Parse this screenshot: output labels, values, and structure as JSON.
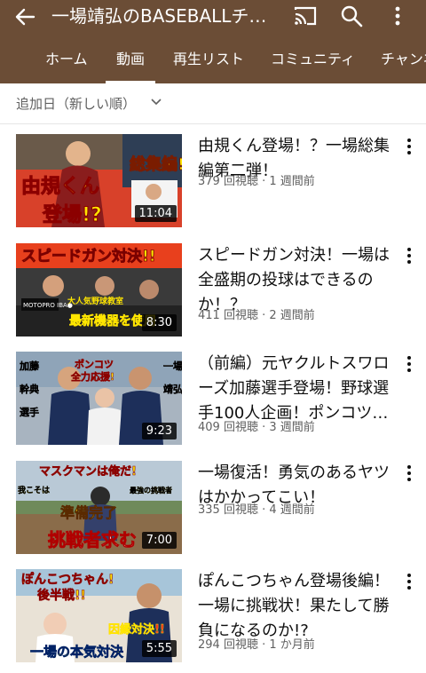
{
  "channel": {
    "title": "一場靖弘のBASEBALLチ…"
  },
  "tabs": [
    {
      "label": "ホーム"
    },
    {
      "label": "動画"
    },
    {
      "label": "再生リスト"
    },
    {
      "label": "コミュニティ"
    },
    {
      "label": "チャンネル"
    }
  ],
  "active_tab": "動画",
  "sort": {
    "label": "追加日（新しい順）"
  },
  "videos": [
    {
      "title": "由規くん登場！？一場総集編第二弾！",
      "views": "379 回視聴",
      "age": "1 週間前",
      "duration": "11:04",
      "thumb_text": [
        "総集編!",
        "由規くん",
        "登場!?"
      ]
    },
    {
      "title": "スピードガン対決！一場は全盛期の投球はできるのか！？",
      "views": "411 回視聴",
      "age": "2 週間前",
      "duration": "8:30",
      "thumb_text": [
        "スピードガン対決!!",
        "大人気野球教室",
        "最新機器を使用",
        "MOTOPRO IBA●"
      ]
    },
    {
      "title": "（前編）元ヤクルトスワローズ加藤選手登場！野球選手100人企画！ポンコツ…",
      "views": "409 回視聴",
      "age": "3 週間前",
      "duration": "9:23",
      "thumb_text": [
        "ポンコツ",
        "全力応援!",
        "加藤",
        "幹典",
        "選手",
        "一場",
        "靖弘"
      ]
    },
    {
      "title": "一場復活！勇気のあるヤツはかかってこい！",
      "views": "335 回視聴",
      "age": "4 週間前",
      "duration": "7:00",
      "thumb_text": [
        "マスクマンは俺だ!",
        "準備完了",
        "挑戦者求む",
        "我こそは",
        "最強の挑戦者"
      ]
    },
    {
      "title": "ぽんこつちゃん登場後編！一場に挑戦状！果たして勝負になるのか!?",
      "views": "294 回視聴",
      "age": "1 か月前",
      "duration": "5:55",
      "thumb_text": [
        "ぽんこつちゃん!",
        "後半戦!!",
        "因縁対決!!",
        "一場の本気対決"
      ]
    }
  ],
  "colors": {
    "header_bg": "#6b4d36",
    "text_primary": "#0f0f0f",
    "text_secondary": "#606060"
  }
}
